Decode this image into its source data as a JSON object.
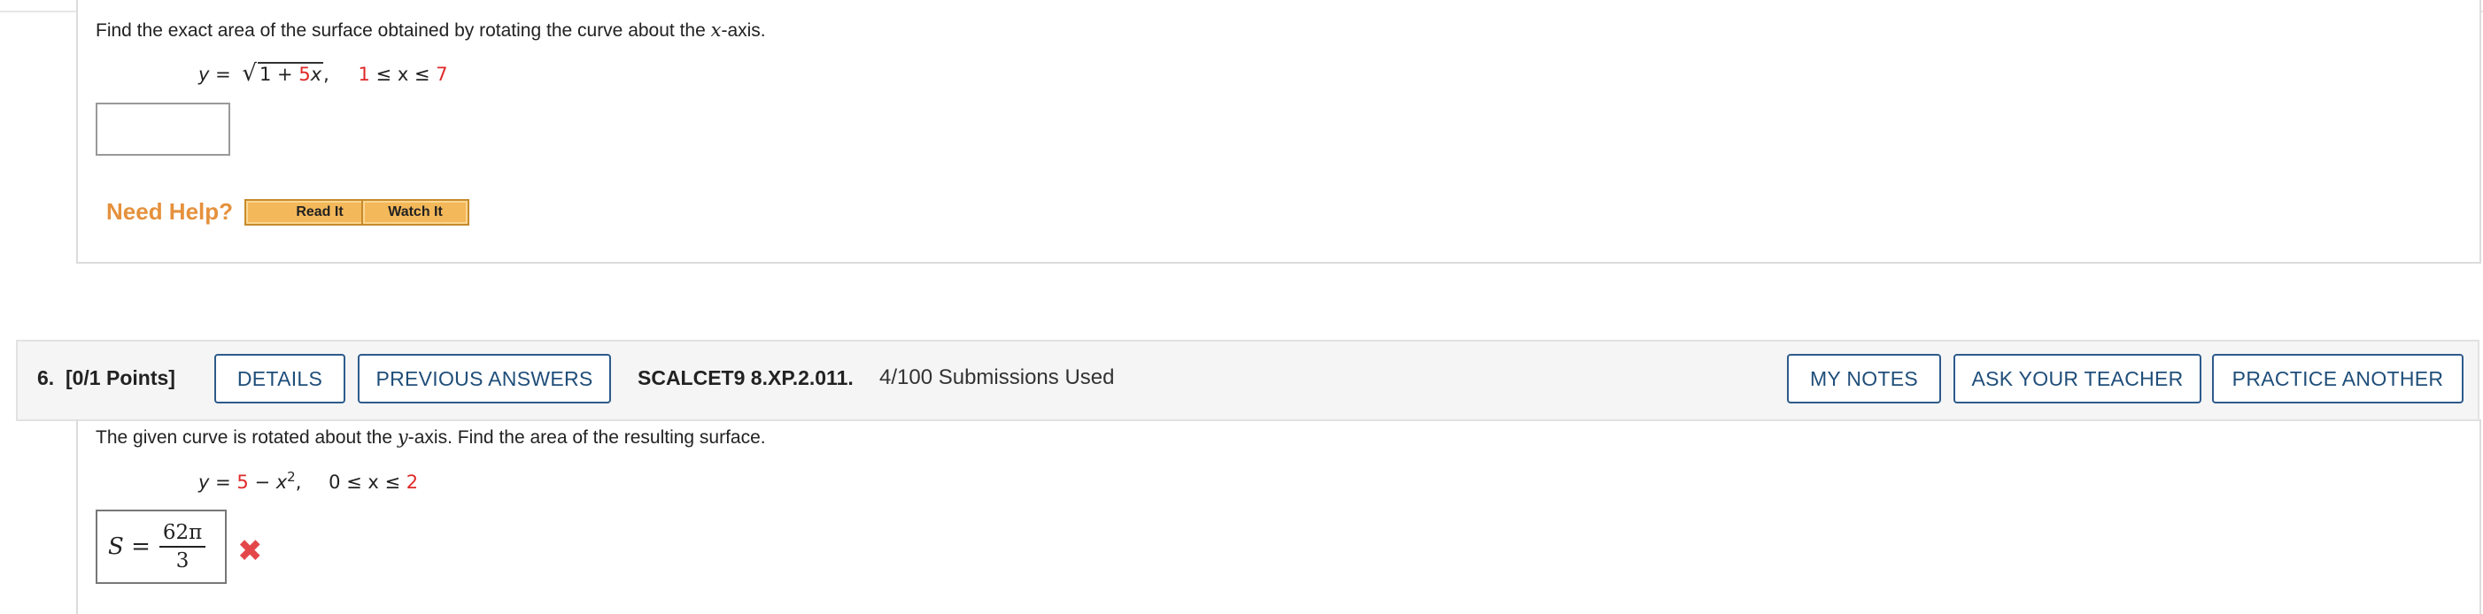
{
  "q5": {
    "prompt_pre": "Find the exact area of the surface obtained by rotating the curve about the ",
    "prompt_var": "x",
    "prompt_post": "-axis.",
    "eq_lhs": "y",
    "eq_equals": "=",
    "sqrt_a": "1 + ",
    "sqrt_b": "5",
    "sqrt_c": "x",
    "comma": ",",
    "range_lo": "1",
    "range_mid": " ≤ x ≤ ",
    "range_hi": "7",
    "answer_value": "",
    "need_help": "Need Help?",
    "read_it": "Read It",
    "watch_it": "Watch It"
  },
  "q6": {
    "number": "6.",
    "points": "[0/1 Points]",
    "details": "DETAILS",
    "previous_answers": "PREVIOUS ANSWERS",
    "source": "SCALCET9 8.XP.2.011.",
    "submissions": "4/100 Submissions Used",
    "my_notes": "MY NOTES",
    "ask_teacher": "ASK YOUR TEACHER",
    "practice_another": "PRACTICE ANOTHER",
    "prompt_pre": "The given curve is rotated about the ",
    "prompt_var": "y",
    "prompt_post": "-axis. Find the area of the resulting surface.",
    "eq_lhs": "y",
    "eq_equals": " = ",
    "eq_a": "5",
    "eq_minus": " − ",
    "eq_x": "x",
    "eq_exp": "2",
    "comma": ",",
    "range_pre": "0 ≤ x ≤ ",
    "range_hi": "2",
    "answer_lhs": "S =",
    "answer_num": "62π",
    "answer_den": "3",
    "status_icon": "incorrect-x-icon"
  },
  "colors": {
    "accent_red": "#e0292a",
    "help_orange": "#e5913d",
    "button_blue": "#1f4e79"
  }
}
